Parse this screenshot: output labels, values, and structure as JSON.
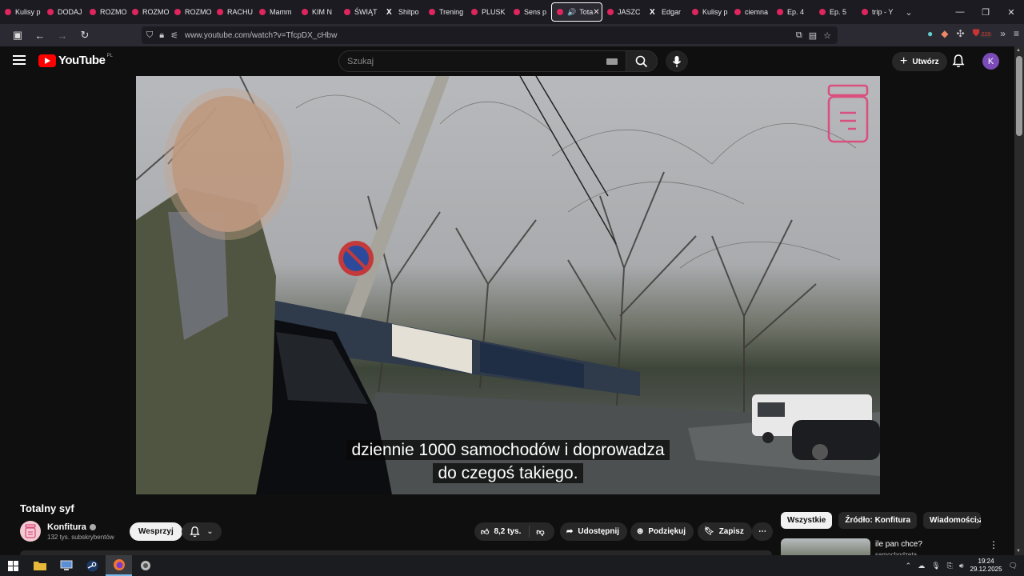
{
  "browser": {
    "tabs": [
      {
        "label": "Kulisy p"
      },
      {
        "label": "DODAJ"
      },
      {
        "label": "ROZMO"
      },
      {
        "label": "ROZMO"
      },
      {
        "label": "ROZMO"
      },
      {
        "label": "RACHU"
      },
      {
        "label": "Mamm"
      },
      {
        "label": "KIM N"
      },
      {
        "label": "ŚWIĄT"
      },
      {
        "label": "Shitpo"
      },
      {
        "label": "Trening"
      },
      {
        "label": "PLUSK"
      },
      {
        "label": "Sens p"
      },
      {
        "label": "Tota"
      },
      {
        "label": "JASZC"
      },
      {
        "label": "Edgar"
      },
      {
        "label": "Kulisy p"
      },
      {
        "label": "ciemna"
      },
      {
        "label": "Ep. 4"
      },
      {
        "label": "Ep. 5"
      },
      {
        "label": "trip - Y"
      }
    ],
    "url": "www.youtube.com/watch?v=TfcpDX_cHbw",
    "extensions_badge": "228"
  },
  "youtube": {
    "logo_text": "YouTube",
    "country_code": "PL",
    "search_placeholder": "Szukaj",
    "create_label": "Utwórz",
    "avatar_letter": "K"
  },
  "video": {
    "caption_line1": "dziennie 1000 samochodów i doprowadza",
    "caption_line2": "do czegoś takiego."
  },
  "details": {
    "title": "Totalny syf",
    "channel_name": "Konfitura",
    "subscribers": "132 tys. subskrybentów",
    "support_label": "Wesprzyj",
    "likes": "8,2 tys.",
    "share_label": "Udostępnij",
    "thanks_label": "Podziękuj",
    "save_label": "Zapisz"
  },
  "sidebar": {
    "chips": [
      "Wszystkie",
      "Źródło: Konfitura",
      "Wiadomości ze ś"
    ],
    "rec_title": "ile pan chce?",
    "rec_channel": "samochodzeta"
  },
  "taskbar": {
    "time": "19:24",
    "date": "29.12.2025"
  },
  "colors": {
    "brand_red": "#ff0000",
    "tab_favicon": "#e0245e",
    "avatar": "#7b4bb7",
    "watermark": "#d94f7d"
  }
}
